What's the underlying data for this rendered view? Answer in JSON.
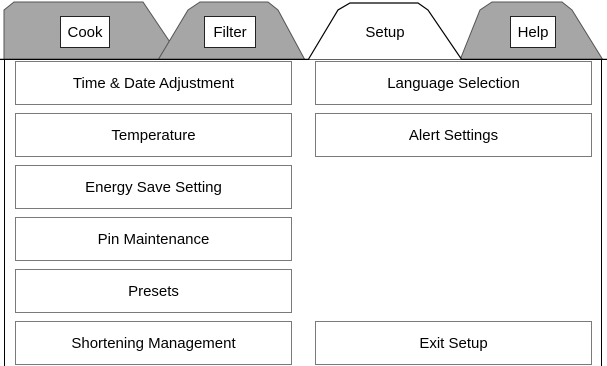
{
  "tabs": [
    {
      "label": "Cook",
      "active": false
    },
    {
      "label": "Filter",
      "active": false
    },
    {
      "label": "Setup",
      "active": true
    },
    {
      "label": "Help",
      "active": false
    }
  ],
  "menu": {
    "left": [
      "Time & Date Adjustment",
      "Temperature",
      "Energy Save Setting",
      "Pin Maintenance",
      "Presets",
      "Shortening Management"
    ],
    "right": [
      "Language Selection",
      "Alert Settings",
      "Exit Setup"
    ]
  },
  "colors": {
    "inactive_tab": "#a6a6a6",
    "active_tab": "#ffffff",
    "button_border": "#7a7a7a",
    "frame_line": "#000000"
  }
}
